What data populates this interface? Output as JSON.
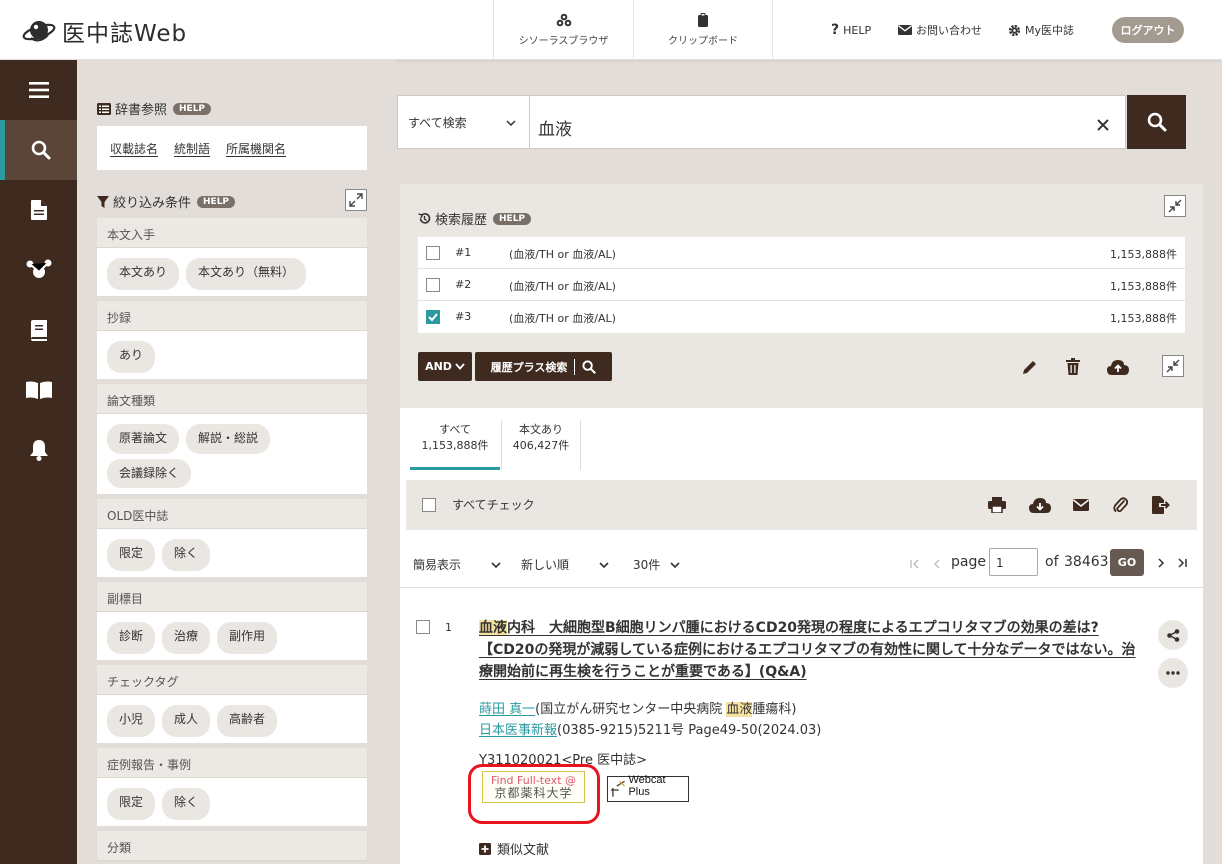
{
  "header": {
    "logo_text": "医中誌Web",
    "nav": [
      {
        "label": "シソーラスブラウザ",
        "icon": "thesaurus-icon"
      },
      {
        "label": "クリップボード",
        "icon": "clipboard-icon"
      }
    ],
    "help_label": "HELP",
    "contact_label": "お問い合わせ",
    "my_label": "My医中誌",
    "logout_label": "ログアウト"
  },
  "sidebar": {
    "items": [
      {
        "icon": "menu-icon"
      },
      {
        "icon": "search-icon",
        "active": true
      },
      {
        "icon": "document-icon"
      },
      {
        "icon": "network-icon"
      },
      {
        "icon": "book-icon"
      },
      {
        "icon": "open-book-icon"
      },
      {
        "icon": "bell-icon"
      }
    ]
  },
  "dictionary": {
    "title": "辞書参照",
    "help": "HELP",
    "links": [
      "収載誌名",
      "統制語",
      "所属機関名"
    ]
  },
  "filters": {
    "title": "絞り込み条件",
    "help": "HELP",
    "sections": [
      {
        "title": "本文入手",
        "chips": [
          "本文あり",
          "本文あり（無料）"
        ]
      },
      {
        "title": "抄録",
        "chips": [
          "あり"
        ]
      },
      {
        "title": "論文種類",
        "chips": [
          "原著論文",
          "解説・総説",
          "会議録除く"
        ]
      },
      {
        "title": "OLD医中誌",
        "chips": [
          "限定",
          "除く"
        ]
      },
      {
        "title": "副標目",
        "chips": [
          "診断",
          "治療",
          "副作用"
        ]
      },
      {
        "title": "チェックタグ",
        "chips": [
          "小児",
          "成人",
          "高齢者"
        ]
      },
      {
        "title": "症例報告・事例",
        "chips": [
          "限定",
          "除く"
        ]
      },
      {
        "title": "分類",
        "chips": []
      }
    ]
  },
  "search": {
    "scope": "すべて検索",
    "query": "血液"
  },
  "history": {
    "title": "検索履歴",
    "help": "HELP",
    "rows": [
      {
        "num": "#1",
        "query": "(血液/TH or 血液/AL)",
        "count": "1,153,888件",
        "checked": false
      },
      {
        "num": "#2",
        "query": "(血液/TH or 血液/AL)",
        "count": "1,153,888件",
        "checked": false
      },
      {
        "num": "#3",
        "query": "(血液/TH or 血液/AL)",
        "count": "1,153,888件",
        "checked": true
      }
    ],
    "and_label": "AND",
    "plus_search_label": "履歴プラス検索"
  },
  "tabs": [
    {
      "label": "すべて",
      "count": "1,153,888件",
      "active": true
    },
    {
      "label": "本文あり",
      "count": "406,427件",
      "active": false
    }
  ],
  "toolbar": {
    "check_all_label": "すべてチェック"
  },
  "pager": {
    "display_mode": "簡易表示",
    "sort": "新しい順",
    "per_page": "30件",
    "page_label": "page",
    "page_value": "1",
    "of_label": "of",
    "total_pages": "38463",
    "go_label": "GO"
  },
  "result": {
    "num": "1",
    "title_hl": "血液",
    "title_rest": "内科　大細胞型B細胞リンパ腫におけるCD20発現の程度によるエプコリタマブの効果の差は?【CD20の発現が減弱している症例におけるエプコリタマブの有効性に関して十分なデータではない。治療開始前に再生検を行うことが重要である】(Q&A)",
    "author": "蒔田 真一",
    "affil_pre": "(国立がん研究センター中央病院 ",
    "affil_hl": "血液",
    "affil_post": "腫瘍科)",
    "journal": "日本医事新報",
    "journal_rest": "(0385-9215)5211号 Page49-50(2024.03)",
    "id_line": "Y311020021<Pre 医中誌>",
    "findfulltext_line1": "Find Full-text @",
    "findfulltext_line2": "京都薬科大学",
    "webcat_label": "Webcat Plus",
    "similar_label": "類似文献"
  }
}
